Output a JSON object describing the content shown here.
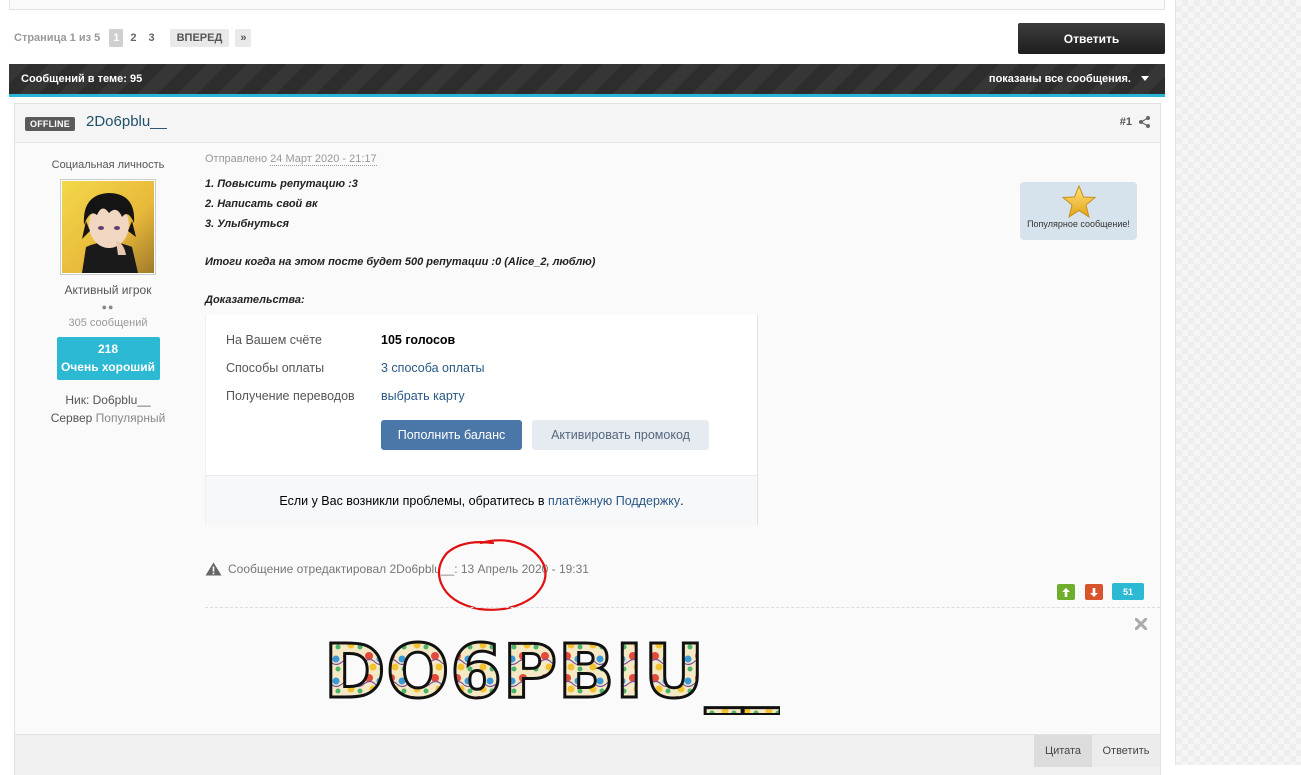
{
  "pagination": {
    "label": "Страница 1 из 5",
    "pages": [
      "1",
      "2",
      "3"
    ],
    "next": "ВПЕРЕД",
    "last": "»"
  },
  "reply_button": "Ответить",
  "topic_bar": {
    "count": "Сообщений в теме: 95",
    "shown": "показаны все сообщения."
  },
  "post": {
    "status": "OFFLINE",
    "author": "2Do6pblu__",
    "number": "#1",
    "author_title": "Социальная личность",
    "group": "Активный игрок",
    "pips": "●●",
    "post_count": "305 сообщений",
    "rep_value": "218",
    "rep_label": "Очень хороший",
    "nick": "Ник: Do6pblu__",
    "server_label": "Сервер",
    "server_value": "Популярный",
    "sent_prefix": "Отправлено",
    "sent_date": "24 Март 2020 - 21:17",
    "body_lines": [
      "1. Повысить репутацию :3",
      "2. Написать свой вк",
      "3. Улыбнуться",
      "Итоги когда на этом посте будет  500 репутации :0 (Alice_2, люблю)",
      "Доказательства:"
    ],
    "popular_label": "Популярное сообщение!",
    "embed": {
      "row1_key": "На Вашем счёте",
      "row1_value": "105 голосов",
      "row2_key": "Способы оплаты",
      "row2_value": "3 способа оплаты",
      "row3_key": "Получение переводов",
      "row3_value": "выбрать карту",
      "btn_primary": "Пополнить баланс",
      "btn_secondary": "Активировать промокод",
      "footer_text": "Если у Вас возникли проблемы, обратитесь в",
      "footer_link": "платёжную Поддержку",
      "footer_end": "."
    },
    "edited_text": "Сообщение отредактировал 2Do6pblu__: 13 Апрель 2020 - 19:31",
    "rep_count": "51",
    "signature_text": "DO6PBIU__",
    "quote_button": "Цитата",
    "reply_button": "Ответить"
  },
  "colors": {
    "accent": "#2cb9d4",
    "topic_bar": "#2f2f2f",
    "vk_blue": "#4a76a8",
    "vote_up": "#6fae2a",
    "vote_down": "#d9532c",
    "annotation": "#e01010"
  },
  "icons": [
    "share-icon",
    "caret-down-icon",
    "star-icon",
    "warning-icon",
    "arrow-up-icon",
    "arrow-down-icon",
    "close-icon"
  ]
}
